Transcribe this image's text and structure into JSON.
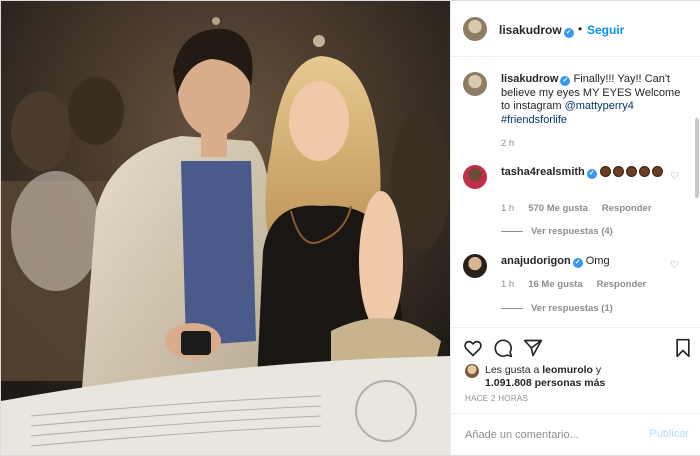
{
  "post": {
    "author": "lisakudrow",
    "follow_label": "Seguir",
    "header_separator": "•"
  },
  "caption": {
    "username": "lisakudrow",
    "text_before": "Finally!!! Yay!! Can't believe my eyes MY EYES Welcome to instagram ",
    "mention": "@mattyperry4",
    "hashtag": "#friendsforlife",
    "time": "2 h"
  },
  "comments": [
    {
      "username": "tasha4realsmith",
      "text": "",
      "emoji_count": 5,
      "time": "1 h",
      "likes": "570 Me gusta",
      "reply_label": "Responder",
      "view_replies": "Ver respuestas (4)"
    },
    {
      "username": "anajudorigon",
      "text": "Omg",
      "time": "1 h",
      "likes": "16 Me gusta",
      "reply_label": "Responder",
      "view_replies": "Ver respuestas (1)"
    }
  ],
  "likes": {
    "prefix": "Les gusta a ",
    "first_user": "leomurolo",
    "connector": " y",
    "count_text": "1.091.808 personas más"
  },
  "timestamp": "HACE 2 HORAS",
  "add_comment": {
    "placeholder": "Añade un comentario...",
    "post_label": "Publicar"
  },
  "icons": {
    "verified": "verified-badge-icon",
    "like": "heart-icon",
    "comment": "comment-icon",
    "share": "share-icon",
    "save": "bookmark-icon"
  },
  "colors": {
    "accent": "#0095f6",
    "verified": "#3897f0",
    "link": "#00376b",
    "muted": "#8e8e8e",
    "post_disabled": "#b2dffc"
  }
}
